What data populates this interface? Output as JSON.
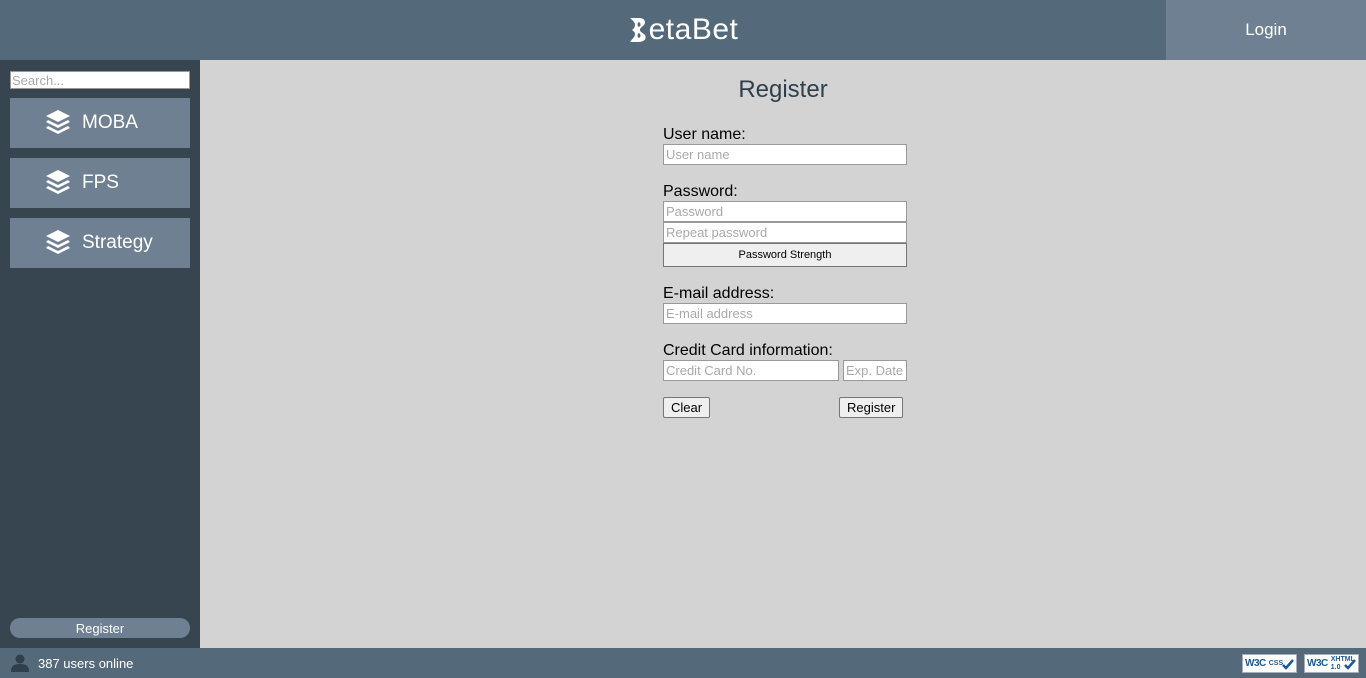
{
  "header": {
    "brand": "BetaBet",
    "brand_text": "etaBet",
    "login_label": "Login"
  },
  "sidebar": {
    "search_placeholder": "Search...",
    "items": [
      {
        "label": "MOBA",
        "icon": "layers-icon"
      },
      {
        "label": "FPS",
        "icon": "layers-icon"
      },
      {
        "label": "Strategy",
        "icon": "layers-icon"
      }
    ],
    "register_label": "Register"
  },
  "main": {
    "title": "Register",
    "form": {
      "username_label": "User name:",
      "username_placeholder": "User name",
      "password_label": "Password:",
      "password_placeholder": "Password",
      "repeat_password_placeholder": "Repeat password",
      "strength_label": "Password Strength",
      "email_label": "E-mail address:",
      "email_placeholder": "E-mail address",
      "card_label": "Credit Card information:",
      "card_number_placeholder": "Credit Card No.",
      "card_exp_placeholder": "Exp. Date",
      "clear_label": "Clear",
      "register_label": "Register"
    }
  },
  "footer": {
    "users_online": "387 users online",
    "badges": [
      {
        "w3c": "W3C",
        "kind": "CSS"
      },
      {
        "w3c": "W3C",
        "kind": "XHTML 1.0"
      }
    ]
  },
  "colors": {
    "header": "#546a7b",
    "sidebar": "#36454f",
    "nav_item": "#6e8092",
    "main_bg": "#d3d3d3"
  }
}
